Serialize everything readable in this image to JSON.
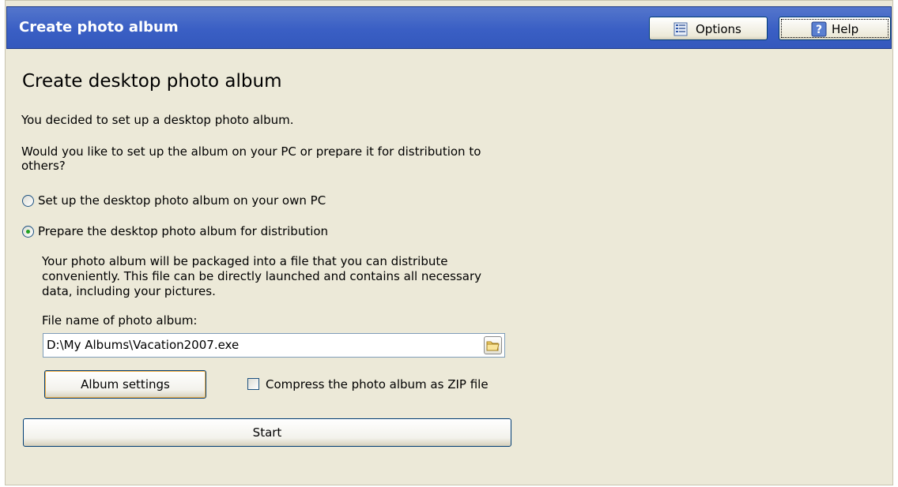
{
  "window": {
    "title": "Create photo album"
  },
  "toolbar": {
    "options_label": "Options",
    "help_label": "Help"
  },
  "main": {
    "heading": "Create desktop photo album",
    "intro": "You decided to set up a desktop photo album.",
    "question_line1": "Would you like to set up the album on your PC or prepare it for distribution to",
    "question_line2": "others?",
    "radio_own_pc": {
      "label": "Set up the desktop photo album on your own PC",
      "selected": false
    },
    "radio_distribution": {
      "label": "Prepare the desktop photo album for distribution",
      "selected": true
    },
    "description_line1": "Your photo album will be packaged into a file that you can distribute",
    "description_line2": "conveniently. This file can be directly launched and contains all necessary",
    "description_line3": "data, including your pictures.",
    "filename_label": "File name of photo album:",
    "filename_value": "D:\\My Albums\\Vacation2007.exe",
    "album_settings_label": "Album settings",
    "compress_label": "Compress the photo album as ZIP file",
    "compress_checked": false,
    "start_label": "Start"
  },
  "icons": {
    "options": "options-list-icon",
    "help": "help-question-icon",
    "browse": "folder-open-icon"
  },
  "colors": {
    "titlebar": "#3a5fc4",
    "panel_bg": "#ece9d8",
    "radio_dot": "#21a121"
  }
}
